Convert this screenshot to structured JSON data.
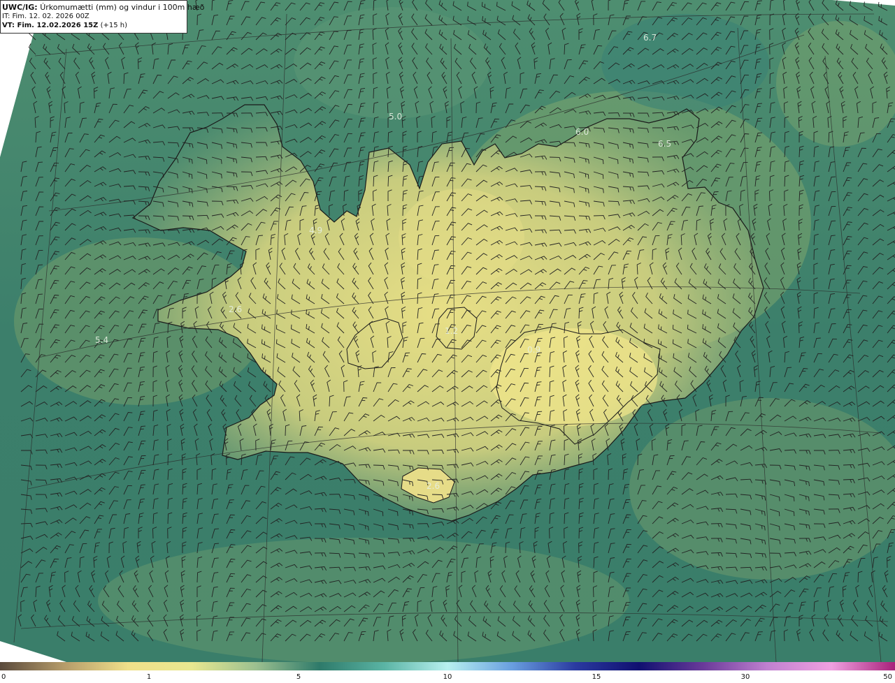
{
  "header": {
    "model_prefix": "UWC/IG:",
    "title": "Úrkomumætti (mm) og vindur i 100m hæð",
    "init_time": "IT: Fim. 12. 02. 2026 00Z",
    "valid_prefix": "VT: Fim. 12.02.2026 15Z",
    "valid_suffix": "(+15 h)"
  },
  "map_labels": [
    {
      "text": "6.7",
      "name": "label-north-6-7"
    },
    {
      "text": "5.0",
      "name": "label-north-5-0"
    },
    {
      "text": "6.0",
      "name": "label-northeast-6-0"
    },
    {
      "text": "6.5",
      "name": "label-northeast-6-5"
    },
    {
      "text": "4.9",
      "name": "label-west-4-9"
    },
    {
      "text": "2.6",
      "name": "label-west-2-6"
    },
    {
      "text": "5.4",
      "name": "label-west-5-4"
    },
    {
      "text": "1.2",
      "name": "label-central-1-2"
    },
    {
      "text": "0.9",
      "name": "label-southeast-0-9"
    },
    {
      "text": "2.6",
      "name": "label-south-2-6"
    }
  ],
  "colorbar": {
    "ticks": [
      "0",
      "1",
      "5",
      "10",
      "15",
      "30",
      "50"
    ],
    "colors": [
      "#5a4a3c",
      "#b59b6a",
      "#f0e08a",
      "#e8e890",
      "#9cc090",
      "#2e7a6a",
      "#5ab4a4",
      "#b8f0f0",
      "#6aa0e0",
      "#2a3aa0",
      "#101070",
      "#6a3a9a",
      "#c080d0",
      "#f0a0e0",
      "#a8207a"
    ]
  }
}
